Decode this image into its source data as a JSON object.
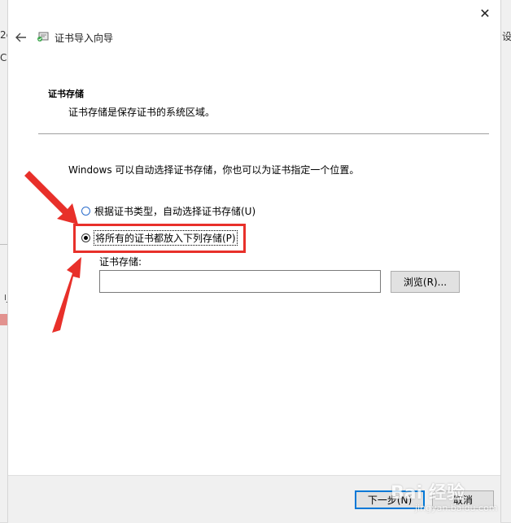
{
  "window": {
    "close_glyph": "✕"
  },
  "wizard": {
    "title": "证书导入向导"
  },
  "section": {
    "heading": "证书存储",
    "description": "证书存储是保存证书的系统区域。"
  },
  "intro": "Windows 可以自动选择证书存储，你也可以为证书指定一个位置。",
  "options": {
    "auto": {
      "label": "根据证书类型，自动选择证书存储(U)",
      "selected": false
    },
    "all": {
      "label": "将所有的证书都放入下列存储(P)",
      "selected": true
    }
  },
  "store": {
    "label": "证书存储:",
    "value": "",
    "browse_label": "浏览(R)..."
  },
  "footer": {
    "next_label": "下一步(N)",
    "cancel_label": "取消"
  },
  "background": {
    "left_fragments": [
      "2c",
      "C",
      "刂"
    ],
    "right_fragments": [
      "设"
    ]
  },
  "watermark": {
    "brand": "Bai 经验",
    "sub": "jingyan.baidu.com"
  },
  "colors": {
    "annotation": "#e8302a",
    "focus_border": "#0078d7",
    "radio_border_blue": "#2b6dcc"
  },
  "icons": {
    "back": "left-arrow-icon",
    "wizard": "certificate-icon",
    "close": "close-icon"
  }
}
